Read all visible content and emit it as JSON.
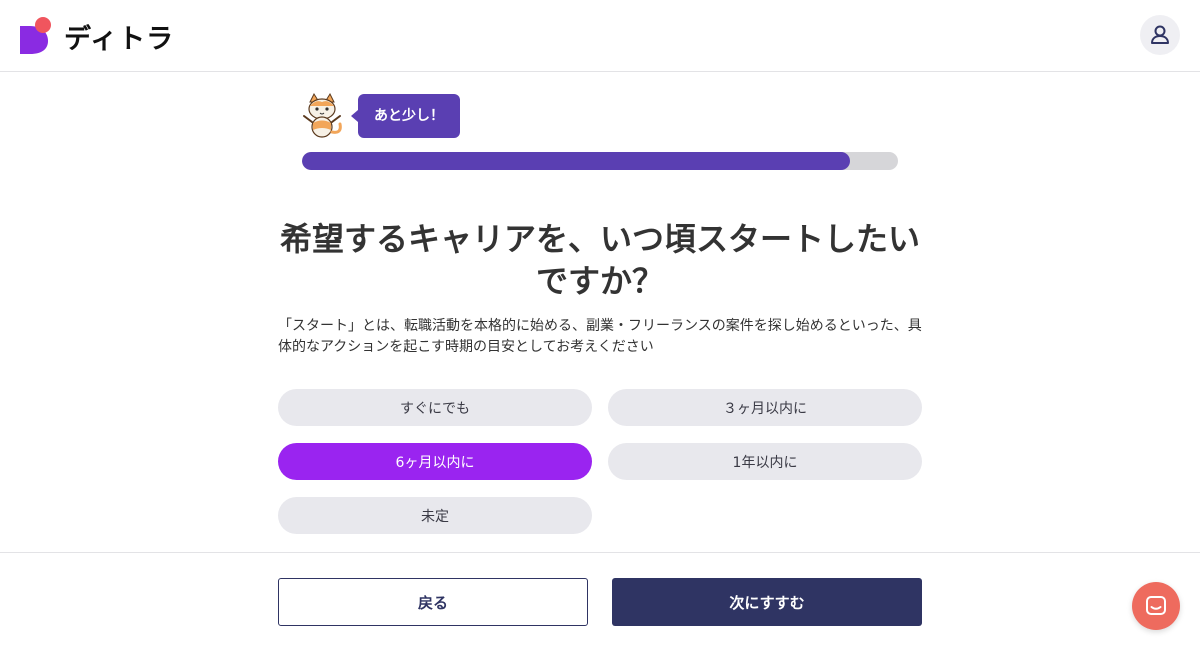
{
  "header": {
    "logo_text": "ディトラ",
    "account_icon": "user-icon"
  },
  "progress": {
    "mascot_message": "あと少し！",
    "value_fraction": 0.92
  },
  "question": {
    "title": "希望するキャリアを、いつ頃スタートしたいですか？",
    "description": "「スタート」とは、転職活動を本格的に始める、副業・フリーランスの案件を探し始めるといった、具体的なアクションを起こす時期の目安としてお考えください"
  },
  "options": [
    {
      "label": "すぐにでも",
      "selected": false
    },
    {
      "label": "３ヶ月以内に",
      "selected": false
    },
    {
      "label": "6ヶ月以内に",
      "selected": true
    },
    {
      "label": "1年以内に",
      "selected": false
    },
    {
      "label": "未定",
      "selected": false
    }
  ],
  "footer": {
    "back_label": "戻る",
    "next_label": "次にすすむ",
    "chat_icon": "chat-icon"
  },
  "colors": {
    "accent": "#5a3fb2",
    "selected_option": "#9a24f0",
    "primary_button": "#2f3463",
    "chat_button": "#ee6b5e",
    "logo_pink": "#f0555e",
    "logo_purple": "#8a2be2"
  }
}
